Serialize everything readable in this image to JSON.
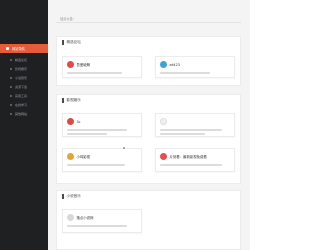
{
  "colors": {
    "sidebar_bg": "#1f2022",
    "active": "#e85b39",
    "content_bg": "#f4f4f5"
  },
  "sidebar": {
    "items": [
      {
        "label": "网站导航",
        "type": "active",
        "icon": "home-icon"
      },
      {
        "label": "精选论坛",
        "type": "sub",
        "icon": "dot-icon"
      },
      {
        "label": "影视娱乐",
        "type": "sub",
        "icon": "dot-icon"
      },
      {
        "label": "小说音乐",
        "type": "sub",
        "icon": "dot-icon"
      },
      {
        "label": "资源下载",
        "type": "sub",
        "icon": "dot-icon"
      },
      {
        "label": "实用工具",
        "type": "sub",
        "icon": "dot-icon"
      },
      {
        "label": "在线学习",
        "type": "sub",
        "icon": "dot-icon"
      },
      {
        "label": "其他网站",
        "type": "sub",
        "icon": "dot-icon"
      },
      {
        "label": "网站发布",
        "type": "main",
        "icon": "upload-icon"
      },
      {
        "label": "申请收录",
        "type": "main",
        "icon": "plus-icon"
      },
      {
        "label": "关于我们",
        "type": "main",
        "icon": "info-icon"
      }
    ]
  },
  "notice": "站点公告：",
  "sections": [
    {
      "title": "精选论坛",
      "cards": [
        {
          "title": "吾爱破解",
          "logo_color": "#e04a4a"
        },
        {
          "title": "zd423",
          "logo_color": "#3aa3d9"
        }
      ]
    },
    {
      "title": "影视娱乐",
      "cards": [
        {
          "title": "3c",
          "logo_color": "#d94c3f"
        },
        {
          "title": "",
          "logo_color": "#f0f0f0"
        },
        {
          "title": "小鸡影视",
          "logo_color": "#e8a23a"
        },
        {
          "title": "片刻看：最新影视免费看",
          "logo_color": "#e94c4c"
        }
      ]
    },
    {
      "title": "小说音乐",
      "cards": [
        {
          "title": "落点小说网",
          "logo_color": "#d8d8d8"
        }
      ]
    }
  ]
}
